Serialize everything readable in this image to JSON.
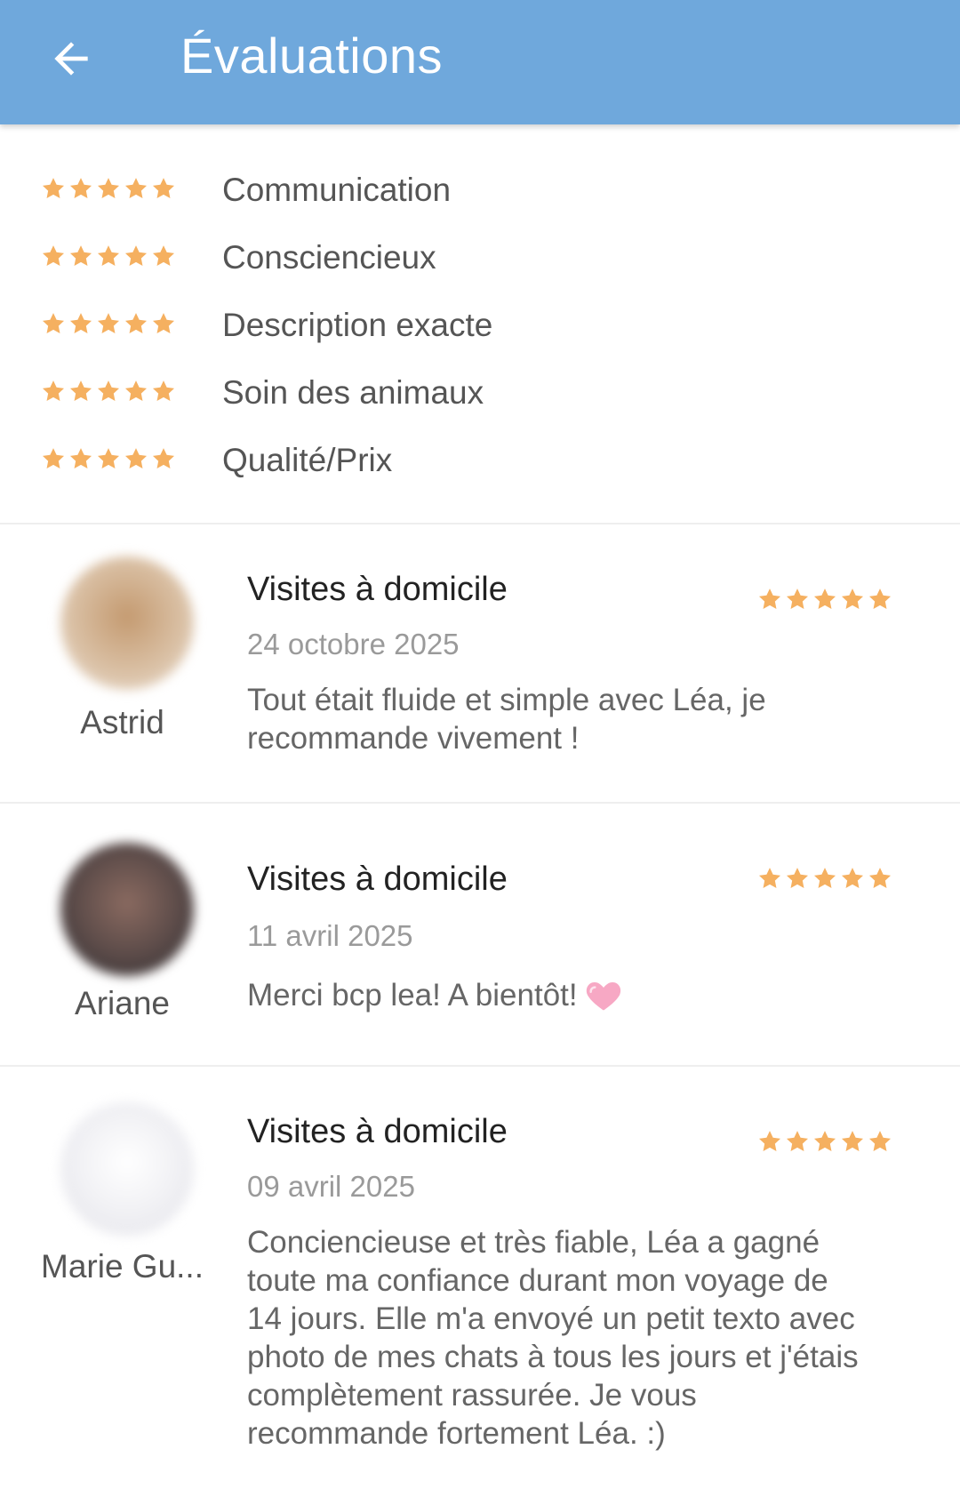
{
  "header": {
    "back_icon": "arrow-left-icon",
    "title": "Évaluations",
    "background": "#6fa8dc"
  },
  "star_color": "#f5b060",
  "criteria": [
    {
      "label": "Communication",
      "rating": 5
    },
    {
      "label": "Consciencieux",
      "rating": 5
    },
    {
      "label": "Description exacte",
      "rating": 5
    },
    {
      "label": "Soin des animaux",
      "rating": 5
    },
    {
      "label": "Qualité/Prix",
      "rating": 5
    }
  ],
  "reviews": [
    {
      "name": "Astrid",
      "service": "Visites à domicile",
      "date": "24 octobre 2025",
      "comment": "Tout était fluide et simple avec Léa, je recommande vivement !",
      "rating": 5
    },
    {
      "name": "Ariane",
      "service": "Visites à domicile",
      "date": "11 avril 2025",
      "comment": "Merci bcp lea! A bientôt!",
      "comment_icon": "pink-heart-emoji",
      "rating": 5
    },
    {
      "name": "Marie Gu...",
      "service": "Visites à domicile",
      "date": "09 avril 2025",
      "comment": "Conciencieuse et très fiable,  Léa a gagné toute ma confiance durant mon voyage de 14 jours. Elle m'a envoyé un petit texto avec photo de mes chats à tous les jours et j'étais complètement rassurée. Je vous recommande fortement Léa. :)",
      "rating": 5
    }
  ]
}
